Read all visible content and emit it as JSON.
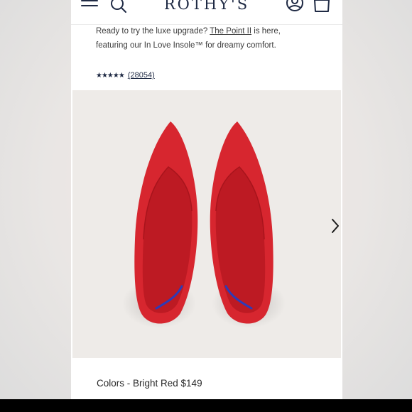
{
  "header": {
    "brand": "ROTHY'S",
    "menu_icon": "hamburger-menu-icon",
    "search_icon": "search-icon",
    "account_icon": "account-icon",
    "bag_icon": "shopping-bag-icon"
  },
  "promo": {
    "text_before": "Ready to try the luxe upgrade? ",
    "link_text": "The Point II",
    "text_after": " is here, featuring our In Love Insole™ for dreamy comfort."
  },
  "rating": {
    "stars_text": "★★★★★",
    "value": 4.5,
    "max": 5,
    "review_count": "(28054)"
  },
  "product": {
    "image_alt": "Red pointed-toe knit flats",
    "shoe_color": "#d7262f",
    "accent_color": "#2d3bb8",
    "next_icon": "chevron-right-icon"
  },
  "variant": {
    "label": "Colors - Bright Red $149"
  }
}
